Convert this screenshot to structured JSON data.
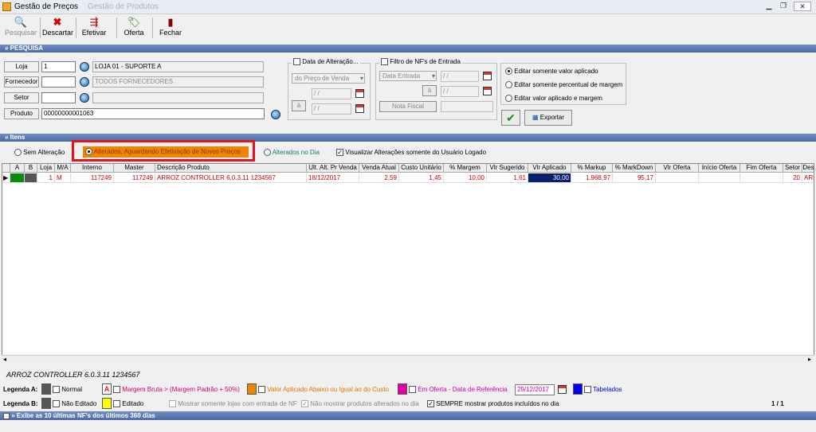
{
  "window": {
    "title": "Gestão de Preços",
    "ghost_title": "Gestão de Produtos",
    "minimize": "▁",
    "restore": "❐",
    "close": "✕"
  },
  "toolbar": {
    "pesquisar": "Pesquisar",
    "descartar": "Descartar",
    "efetivar": "Efetivar",
    "oferta": "Oferta",
    "fechar": "Fechar"
  },
  "sections": {
    "pesquisa": "» PESQUISA",
    "itens": "» Itens",
    "footer": "» Exibe as 10 últimas NF's dos últimos 360 dias"
  },
  "search": {
    "loja_label": "Loja",
    "loja_value": "1",
    "loja_desc": "LOJA 01 - SUPORTE A",
    "fornecedor_label": "Fornecedor",
    "fornecedor_value": "",
    "fornecedor_desc": "TODOS FORNECEDORES",
    "setor_label": "Setor",
    "setor_value": "",
    "setor_desc": "",
    "produto_label": "Produto",
    "produto_value": "00000000001063"
  },
  "data_alteracao": {
    "title": "Data de Alteração...",
    "dropdown": "do Preço de Venda",
    "from": " / /",
    "to_label": "à",
    "to": " / /"
  },
  "filtro_nf": {
    "title": "Filtro de NF's de Entrada",
    "dropdown": "Data Entrada",
    "from": " / /",
    "to_label": "à",
    "to": " / /",
    "nota_label": "Nota Fiscal",
    "nota_value": ""
  },
  "edit_mode": {
    "options": [
      "Editar somente valor aplicado",
      "Editar somente percentual de margem",
      "Editar valor aplicado e margem"
    ],
    "selected": 0
  },
  "actions": {
    "confirm_icon": "✔",
    "exportar": "Exportar"
  },
  "filters": {
    "sem_alteracao": "Sem Alteração",
    "alterados": "Alterados, Aguardando Efetivação de Novos Preços",
    "alterados_dia": "Alterados no Dia",
    "visualizar": "Visualizar Alterações somente do Usuário Logado"
  },
  "table": {
    "headers": [
      "A",
      "B",
      "Loja",
      "M/A",
      "Interno",
      "Master",
      "Descrição Produto",
      "Ult. Alt. Pr Venda",
      "Venda Atual",
      "Custo Unitário",
      "% Margem",
      "Vlr Sugerido",
      "Vlr Aplicado",
      "% Markup",
      "% MarkDown",
      "Vlr Oferta",
      "Início Oferta",
      "Fim Oferta",
      "Setor",
      "Des"
    ],
    "rows": [
      [
        "",
        "",
        "1",
        "M",
        "117249",
        "117249",
        "ARROZ  CONTROLLER 6.0.3.11 1234567",
        "18/12/2017",
        "2,59",
        "1,45",
        "10,00",
        "1,61",
        "30,00",
        "1.968,97",
        "95,17",
        "",
        "",
        "",
        "20",
        "ARR"
      ]
    ]
  },
  "status": {
    "product_name": "ARROZ  CONTROLLER 6.0.3.11 1234567",
    "page": "1 / 1"
  },
  "legend_a": {
    "label": "Legenda A:",
    "normal": "Normal",
    "a_mark": "A",
    "margem": "Margem Bruta > (Margem Padrão + 50%)",
    "abaixo": "Valor Aplicado Abaixo ou Igual ao do Custo",
    "oferta": "Em Oferta - Data de Referência",
    "oferta_date": "29/12/2017",
    "tabelados": "Tabelados"
  },
  "legend_b": {
    "label": "Legenda B:",
    "nao_editado": "Não Editado",
    "editado": "Editado",
    "lojas_nf": "Mostrar somente lojas com entrada de NF",
    "nao_mostrar": "Não mostrar produtos alterados no dia",
    "sempre": "SEMPRE mostrar produtos incluídos no dia"
  },
  "colors": {
    "highlight_red": "#e8131a",
    "orange": "#f08400",
    "magenta": "#e0009f",
    "blue": "#0000ee",
    "yellow": "#ffff00",
    "dark_gray": "#555555",
    "navy": "#0a1e6e"
  }
}
